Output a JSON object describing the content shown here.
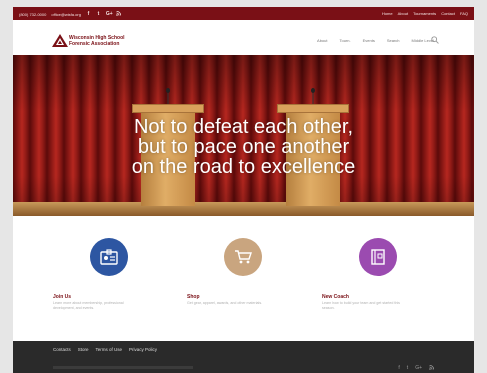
{
  "topbar": {
    "phone": "(800) 732-0000",
    "email": "office@wisfa.org",
    "social": [
      "f",
      "t",
      "G+",
      "rss"
    ],
    "links": [
      "Home",
      "About",
      "Tournaments",
      "Contact",
      "FAQ"
    ]
  },
  "header": {
    "logo_line1": "Wisconsin High School",
    "logo_line2": "Forensic Association",
    "nav": [
      "About",
      "Tourn.",
      "Events",
      "Search",
      "Middle Level"
    ],
    "colors": {
      "brand": "#7a1016"
    }
  },
  "hero": {
    "lines": [
      "Not to defeat each other,",
      "but to pace one another",
      "on the road to excellence"
    ]
  },
  "features": [
    {
      "title": "Join Us",
      "desc": "Learn more about membership, professional development, and events.",
      "icon": "id-card-icon",
      "color": "#2d56a2"
    },
    {
      "title": "Shop",
      "desc": "Get gear, apparel, awards, and other materials.",
      "icon": "cart-icon",
      "color": "#c9a57f"
    },
    {
      "title": "New Coach",
      "desc": "Learn how to build your team and get started this season.",
      "icon": "book-icon",
      "color": "#9b4bb0"
    }
  ],
  "footer": {
    "links": [
      "Contacts",
      "Store",
      "Terms of Use",
      "Privacy Policy"
    ],
    "social": [
      "f",
      "t",
      "G+",
      "rss"
    ]
  }
}
